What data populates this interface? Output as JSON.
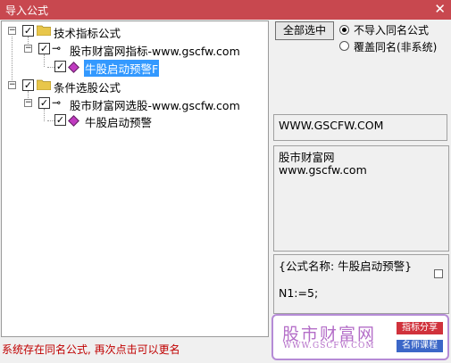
{
  "window": {
    "title": "导入公式",
    "close_glyph": "✕"
  },
  "tree": {
    "nodes": [
      {
        "label": "技术指标公式",
        "checked": true,
        "expander": "−"
      },
      {
        "label": "股市财富网指标-www.gscfw.com",
        "checked": true,
        "expander": "−"
      },
      {
        "label": "牛股启动预警F",
        "checked": true,
        "selected": true
      },
      {
        "label": "条件选股公式",
        "checked": true,
        "expander": "−"
      },
      {
        "label": "股市财富网选股-www.gscfw.com",
        "checked": true,
        "expander": "−"
      },
      {
        "label": "牛股启动预警",
        "checked": true
      }
    ],
    "check_glyph": "✓"
  },
  "select_all_button": "全部选中",
  "options": [
    {
      "label": "不导入同名公式",
      "selected": true
    },
    {
      "label": "覆盖同名(非系统)",
      "selected": false
    }
  ],
  "site_text": "WWW.GSCFW.COM",
  "description": {
    "line1": "股市财富网",
    "line2": "www.gscfw.com"
  },
  "formula": {
    "name_line": "{公式名称: 牛股启动预警}",
    "code_line": "N1:=5;"
  },
  "status_message": "系统存在同名公式, 再次点击可以更名",
  "watermark": {
    "name": "股市财富网",
    "url": "WWW.GSCFW.COM",
    "tag1": "指标分享",
    "tag2": "名师课程",
    "tag1_color": "#d0323c",
    "tag2_color": "#3b67c8"
  }
}
